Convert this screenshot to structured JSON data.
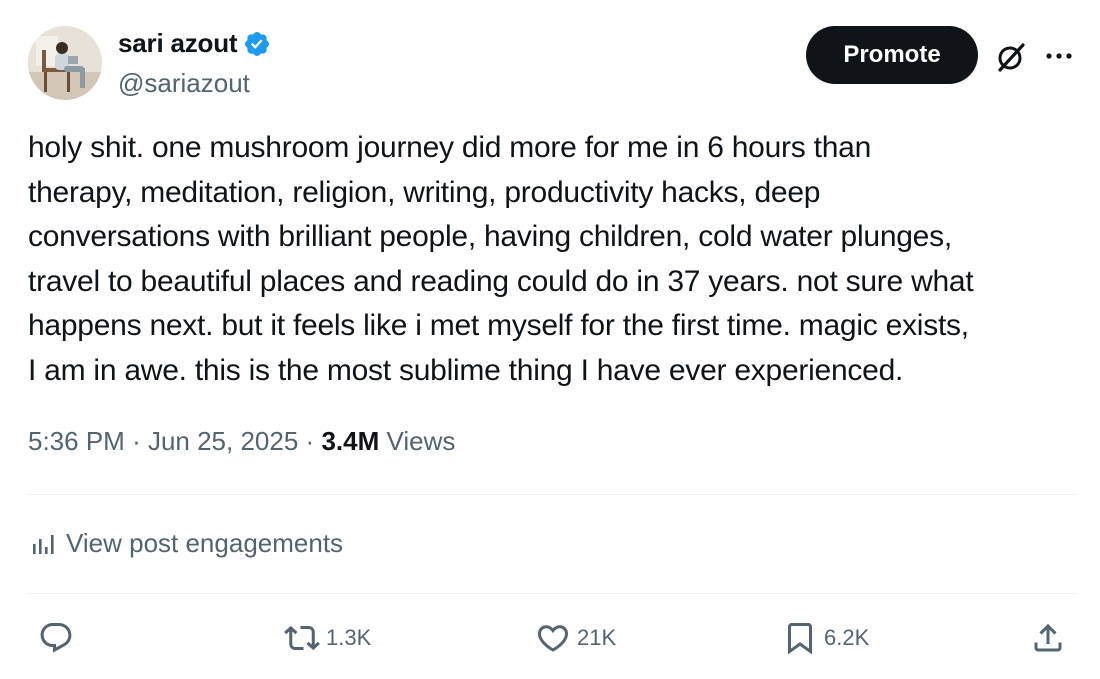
{
  "author": {
    "name": "sari azout",
    "handle": "@sariazout",
    "verified": true
  },
  "header": {
    "promote_label": "Promote"
  },
  "post": {
    "lines": [
      "holy shit. one mushroom journey did more for me in 6 hours than",
      "therapy, meditation, religion, writing, productivity hacks, deep",
      "conversations with brilliant people, having children, cold water plunges,",
      "travel to beautiful places and reading could do in 37 years. not sure what",
      "happens next. but it feels like i met myself for the first time. magic exists,",
      "I am in awe. this is the most sublime thing I have ever experienced."
    ]
  },
  "meta": {
    "time": "5:36 PM",
    "separator": "·",
    "date": "Jun 25, 2025",
    "views_count": "3.4M",
    "views_label": "Views"
  },
  "engagements": {
    "label": "View post engagements"
  },
  "actions": {
    "reply_count": "",
    "repost_count": "1.3K",
    "like_count": "21K",
    "bookmark_count": "6.2K"
  },
  "colors": {
    "text_primary": "#0f1419",
    "text_secondary": "#536471",
    "verified_blue": "#1d9bf0",
    "divider": "#eff3f4",
    "button_dark": "#0f1419"
  },
  "icons": {
    "verified": "verified-badge-icon",
    "grok": "grok-icon",
    "more": "more-icon",
    "analytics": "analytics-icon",
    "reply": "reply-icon",
    "repost": "repost-icon",
    "like": "like-icon",
    "bookmark": "bookmark-icon",
    "share": "share-icon"
  }
}
